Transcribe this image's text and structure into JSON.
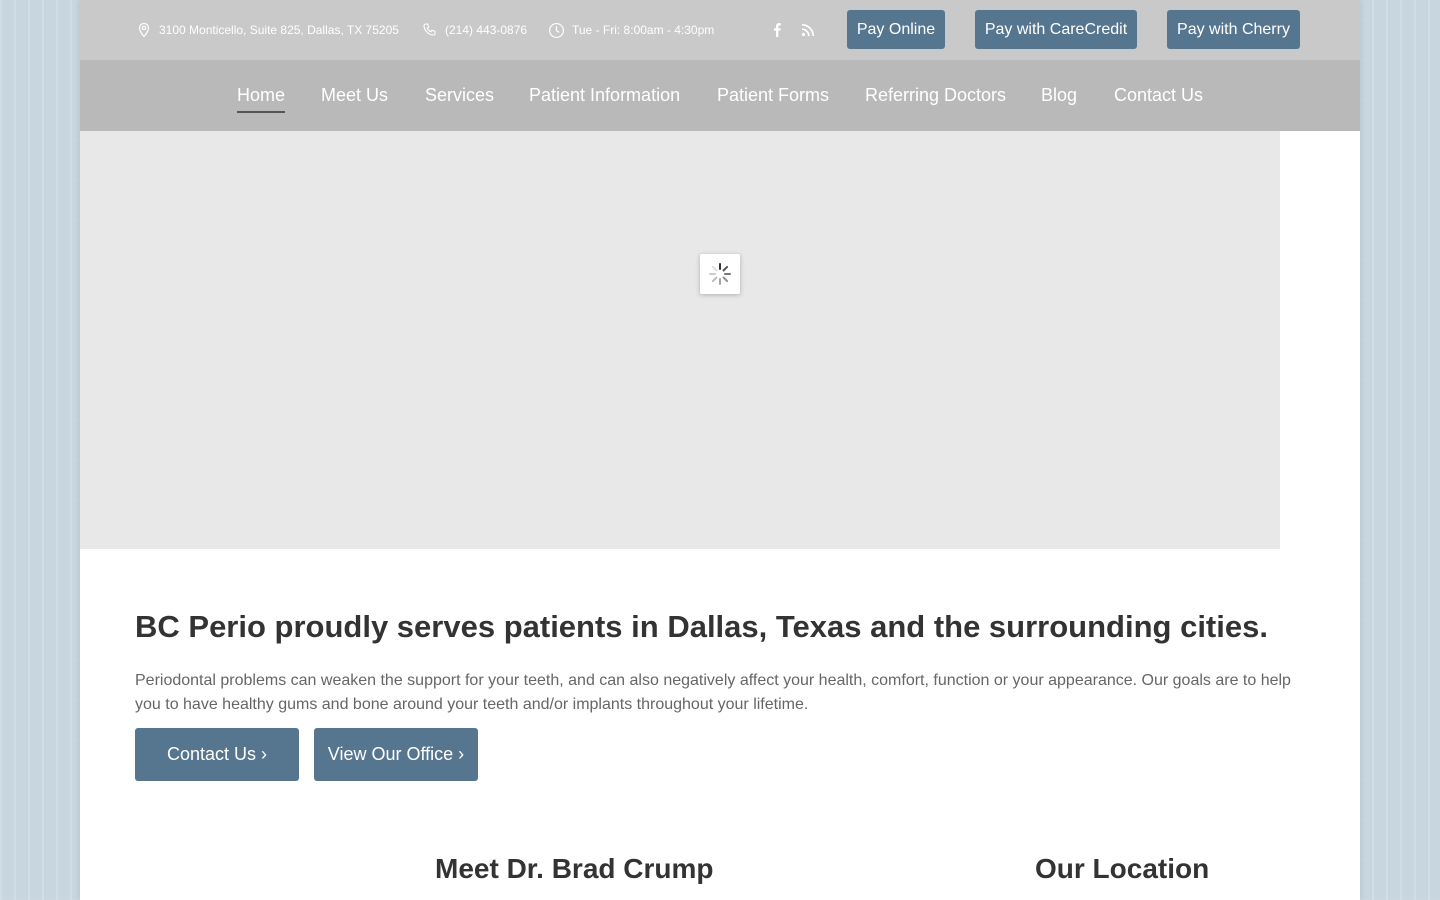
{
  "topbar": {
    "address": "3100 Monticello, Suite 825, Dallas, TX 75205",
    "phone": "(214) 443-0876",
    "hours": "Tue - Fri: 8:00am - 4:30pm",
    "social": [
      "facebook-icon",
      "rss-icon"
    ],
    "pay_buttons": [
      "Pay Online",
      "Pay with CareCredit",
      "Pay with Cherry"
    ]
  },
  "nav": {
    "items": [
      "Home",
      "Meet Us",
      "Services",
      "Patient Information",
      "Patient Forms",
      "Referring Doctors",
      "Blog",
      "Contact Us"
    ],
    "active": "Home"
  },
  "hero": {
    "state": "loading",
    "icon": "spinner-icon"
  },
  "intro": {
    "headline_brand": "BC Perio",
    "headline_rest": " proudly serves patients in Dallas, Texas and the surrounding cities.",
    "paragraph": "Periodontal problems can weaken the support for your teeth, and can also negatively affect your health, comfort, function or your appearance. Our goals are to help you to have healthy gums and bone around your teeth and/or implants throughout your lifetime.",
    "buttons": [
      "Contact Us ›",
      "View Our Office ›"
    ]
  },
  "sections": {
    "meet_title": "Meet Dr. Brad Crump",
    "location_title": "Our Location"
  },
  "colors": {
    "accent": "#56768f",
    "topbar_bg": "#c9c9c9",
    "nav_bg": "#b9b9b9",
    "hero_bg": "#e8e8e8",
    "page_bg": "#cfdce6"
  }
}
